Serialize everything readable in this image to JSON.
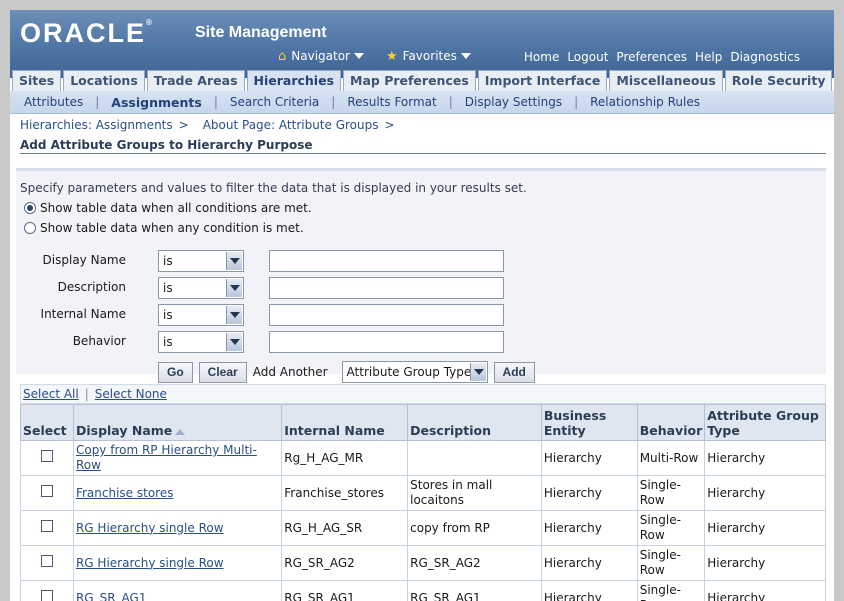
{
  "header": {
    "logo": "ORACLE",
    "app_title": "Site Management",
    "navigator": "Navigator",
    "favorites": "Favorites",
    "global_links": [
      "Home",
      "Logout",
      "Preferences",
      "Help",
      "Diagnostics"
    ]
  },
  "tabs": [
    "Sites",
    "Locations",
    "Trade Areas",
    "Hierarchies",
    "Map Preferences",
    "Import Interface",
    "Miscellaneous",
    "Role Security"
  ],
  "active_tab": "Hierarchies",
  "subtabs": [
    "Attributes",
    "Assignments",
    "Search Criteria",
    "Results Format",
    "Display Settings",
    "Relationship Rules"
  ],
  "active_subtab": "Assignments",
  "breadcrumbs": [
    "Hierarchies: Assignments",
    "About Page: Attribute Groups"
  ],
  "page_title": "Add Attribute Groups to Hierarchy Purpose",
  "search": {
    "hint": "Specify parameters and values to filter the data that is displayed in your results set.",
    "radio_all": "Show table data when all conditions are met.",
    "radio_any": "Show table data when any condition is met.",
    "fields": [
      {
        "label": "Display Name",
        "operator": "is",
        "value": ""
      },
      {
        "label": "Description",
        "operator": "is",
        "value": ""
      },
      {
        "label": "Internal Name",
        "operator": "is",
        "value": ""
      },
      {
        "label": "Behavior",
        "operator": "is",
        "value": ""
      }
    ],
    "go_label": "Go",
    "clear_label": "Clear",
    "add_another_label": "Add Another",
    "add_another_select": "Attribute Group Type",
    "add_label": "Add"
  },
  "table": {
    "select_all": "Select All",
    "select_none": "Select None",
    "headers": [
      "Select",
      "Display Name",
      "Internal Name",
      "Description",
      "Business Entity",
      "Behavior",
      "Attribute Group Type"
    ],
    "rows": [
      {
        "display": "Copy from RP Hierarchy Multi-Row",
        "internal": "Rg_H_AG_MR",
        "description": "",
        "entity": "Hierarchy",
        "behavior": "Multi-Row",
        "type": "Hierarchy"
      },
      {
        "display": "Franchise stores",
        "internal": "Franchise_stores",
        "description": "Stores in mall locaitons",
        "entity": "Hierarchy",
        "behavior": "Single-Row",
        "type": "Hierarchy"
      },
      {
        "display": "RG Hierarchy single Row",
        "internal": "RG_H_AG_SR",
        "description": "copy from RP",
        "entity": "Hierarchy",
        "behavior": "Single-Row",
        "type": "Hierarchy"
      },
      {
        "display": "RG Hierarchy single Row",
        "internal": "RG_SR_AG2",
        "description": "RG_SR_AG2",
        "entity": "Hierarchy",
        "behavior": "Single-Row",
        "type": "Hierarchy"
      },
      {
        "display": "RG_SR_AG1",
        "internal": "RG_SR_AG1",
        "description": "RG_SR_AG1",
        "entity": "Hierarchy",
        "behavior": "Single-Row",
        "type": "Hierarchy"
      }
    ]
  }
}
